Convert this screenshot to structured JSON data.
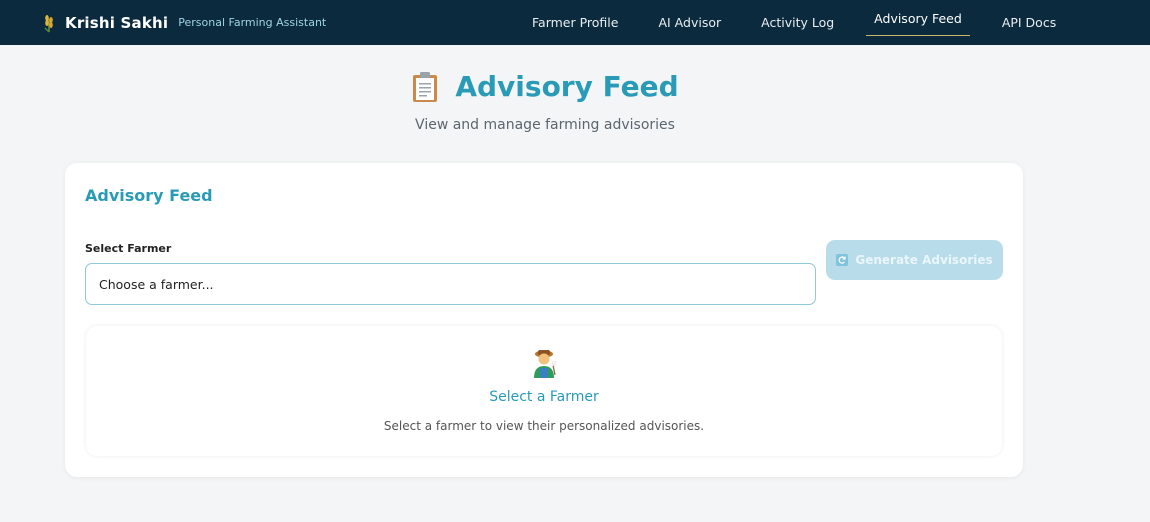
{
  "nav": {
    "brand_name": "Krishi Sakhi",
    "brand_tagline": "Personal Farming Assistant",
    "links": [
      {
        "label": "Farmer Profile"
      },
      {
        "label": "AI Advisor"
      },
      {
        "label": "Activity Log"
      },
      {
        "label": "Advisory Feed",
        "active": true
      },
      {
        "label": "API Docs"
      }
    ]
  },
  "header": {
    "title": "Advisory Feed",
    "subtitle": "View and manage farming advisories",
    "icon": "clipboard-icon"
  },
  "card": {
    "title": "Advisory Feed",
    "select_label": "Select Farmer",
    "select_value": "Choose a farmer...",
    "generate_button": "Generate Advisories",
    "generate_icon": "refresh-icon",
    "empty_state": {
      "icon": "farmer-icon",
      "title": "Select a Farmer",
      "text": "Select a farmer to view their personalized advisories."
    }
  },
  "colors": {
    "navbar_bg": "#0b2a3d",
    "accent": "#2a9bb7",
    "button_disabled_bg": "#b8dcea",
    "page_bg": "#f4f5f6"
  }
}
